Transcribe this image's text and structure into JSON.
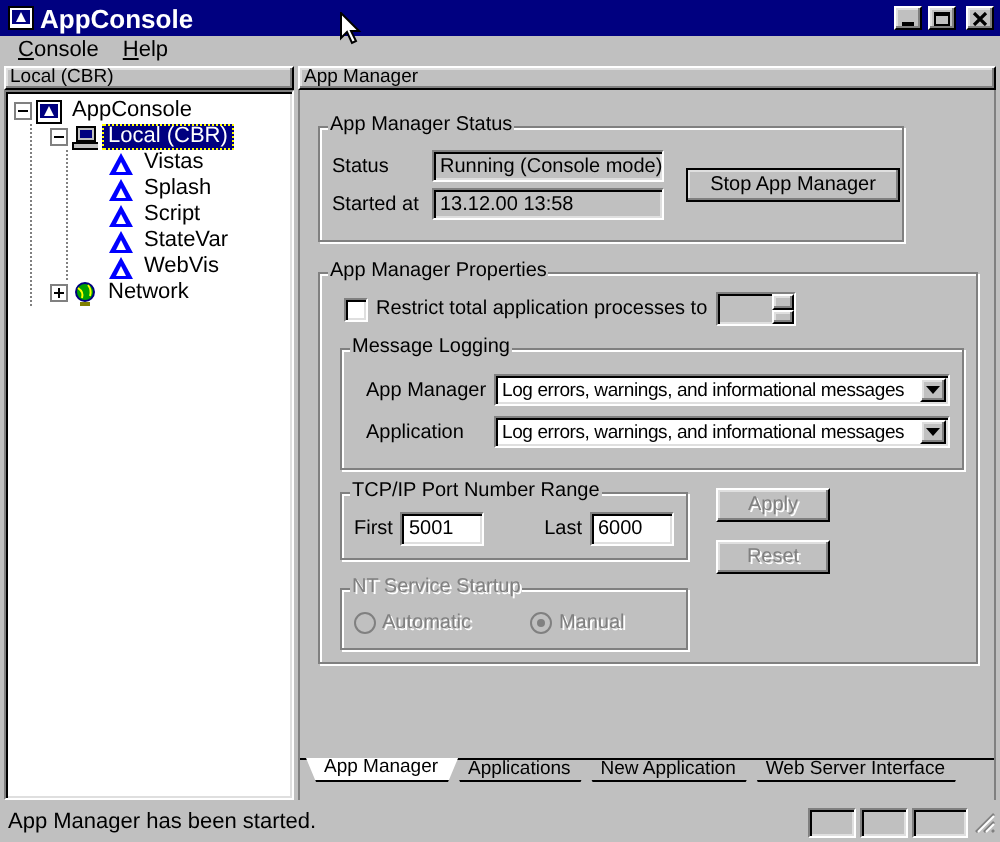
{
  "window": {
    "title": "AppConsole"
  },
  "menu": [
    {
      "label": "Console"
    },
    {
      "label": "Help"
    }
  ],
  "left_pane": {
    "header": "Local (CBR)",
    "tree": [
      {
        "label": "AppConsole",
        "kind": "console",
        "expanded": true,
        "selected": false,
        "children": [
          {
            "label": "Local (CBR)",
            "kind": "computer",
            "expanded": true,
            "selected": true,
            "children": [
              {
                "label": "Vistas",
                "kind": "app",
                "selected": false
              },
              {
                "label": "Splash",
                "kind": "app",
                "selected": false
              },
              {
                "label": "Script",
                "kind": "app",
                "selected": false
              },
              {
                "label": "StateVar",
                "kind": "app",
                "selected": false
              },
              {
                "label": "WebVis",
                "kind": "app",
                "selected": false
              }
            ]
          },
          {
            "label": "Network",
            "kind": "network",
            "expanded": false,
            "selected": false
          }
        ]
      }
    ]
  },
  "right_pane": {
    "header": "App Manager",
    "status_group": {
      "title": "App Manager Status",
      "status_label": "Status",
      "status_value": "Running (Console mode)",
      "started_label": "Started at",
      "started_value": "13.12.00 13:58",
      "stop_button": "Stop App Manager"
    },
    "properties_group": {
      "title": "App Manager Properties",
      "restrict": {
        "label": "Restrict total application processes to",
        "checked": false,
        "spinner_disabled": true
      },
      "logging": {
        "title": "Message Logging",
        "rows": [
          {
            "label": "App Manager",
            "value": "Log errors, warnings, and informational messages"
          },
          {
            "label": "Application",
            "value": "Log errors, warnings, and informational messages"
          }
        ]
      },
      "port_range": {
        "title": "TCP/IP Port Number Range",
        "first_label": "First",
        "first_value": "5001",
        "last_label": "Last",
        "last_value": "6000"
      },
      "nt_service": {
        "title": "NT Service Startup",
        "disabled": true,
        "options": [
          {
            "label": "Automatic",
            "selected": false
          },
          {
            "label": "Manual",
            "selected": true
          }
        ]
      },
      "buttons": [
        {
          "label": "Apply",
          "disabled": true
        },
        {
          "label": "Reset",
          "disabled": true
        }
      ]
    },
    "tabs": [
      {
        "label": "App Manager",
        "selected": true
      },
      {
        "label": "Applications",
        "selected": false
      },
      {
        "label": "New Application",
        "selected": false
      },
      {
        "label": "Web Server Interface",
        "selected": false
      }
    ]
  },
  "status_bar": {
    "text": "App Manager has been started."
  }
}
